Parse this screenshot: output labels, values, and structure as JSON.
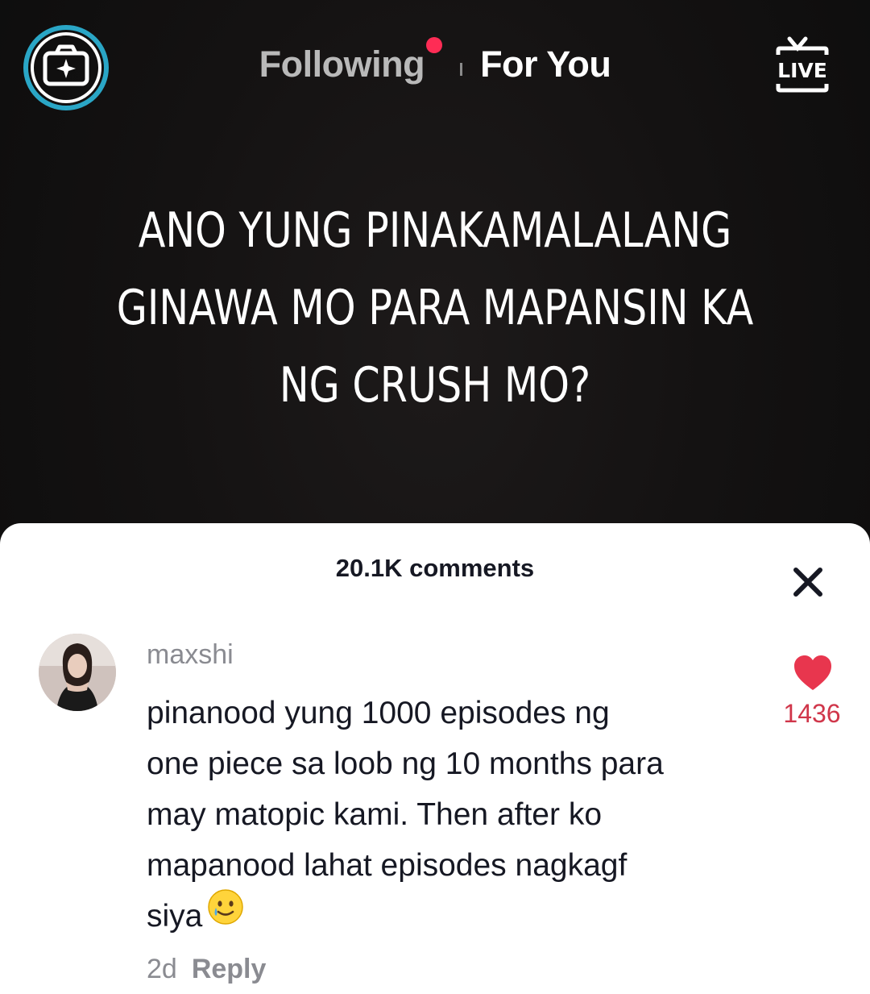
{
  "top_bar": {
    "tabs": [
      {
        "label": "Following",
        "has_notification": true
      },
      {
        "label": "For You",
        "active": true
      }
    ],
    "camera_icon": "camera-sparkle-icon",
    "live_label": "LIVE"
  },
  "video": {
    "caption_lines": [
      "ANO YUNG PINAKAMALALANG",
      "GINAWA MO PARA MAPANSIN KA",
      "NG CRUSH MO?"
    ]
  },
  "comments_panel": {
    "title": "20.1K comments",
    "close_icon": "close-icon",
    "comment": {
      "username": "maxshi",
      "lines": [
        "pinanood yung 1000 episodes ng",
        "one piece sa loob ng 10 months para",
        "may matopic kami. Then after ko",
        "mapanood lahat episodes nagkagf",
        "siya"
      ],
      "emoji": "smiling-face-with-tear",
      "time": "2d",
      "reply_label": "Reply",
      "likes": "1436"
    }
  },
  "colors": {
    "accent_red": "#fe2c55",
    "like_red": "#d0364a",
    "camera_ring": "#2aa6c6",
    "muted_text": "#8a8b91"
  }
}
